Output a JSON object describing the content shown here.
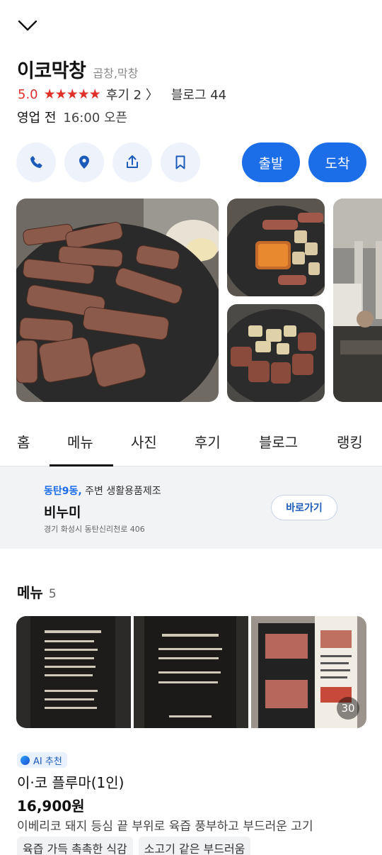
{
  "place": {
    "name": "이코막창",
    "category": "곱창,막창",
    "rating": "5.0",
    "stars": "★★★★★",
    "review_link": "후기 2 〉",
    "blog_link": "블로그 44",
    "hours_status": "영업 전",
    "hours_time": "16:00 오픈"
  },
  "actions": {
    "icons": [
      "phone-icon",
      "map-pin-icon",
      "share-icon",
      "bookmark-icon"
    ],
    "depart_label": "출발",
    "arrive_label": "도착",
    "accent_color": "#1c6ee8"
  },
  "tabs": [
    {
      "label": "홈"
    },
    {
      "label": "메뉴"
    },
    {
      "label": "사진"
    },
    {
      "label": "후기"
    },
    {
      "label": "블로그"
    },
    {
      "label": "랭킹"
    }
  ],
  "active_tab": "메뉴",
  "ad": {
    "location": "동탄9동,",
    "headline": "주변 생활용품제조",
    "name": "비누미",
    "address": "경기 화성시 동탄신리천로 406",
    "button_label": "바로가기"
  },
  "menu": {
    "title": "메뉴",
    "count": "5",
    "photo_count": "30",
    "item": {
      "badge": "AI 추천",
      "name": "이·코 플루마(1인)",
      "price": "16,900원",
      "description": "이베리코 돼지 등심 끝 부위로 육즙 풍부하고 부드러운 고기",
      "tags": [
        "육즙 가득 촉촉한 식감",
        "소고기 같은 부드러움"
      ]
    }
  }
}
